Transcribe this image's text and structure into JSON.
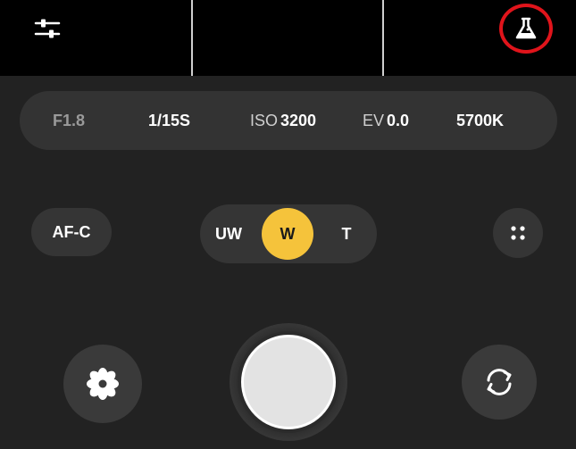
{
  "topbar": {
    "settings_icon": "sliders-icon",
    "lab_icon": "flask-icon",
    "highlight_color": "#e0141b"
  },
  "params": {
    "aperture": "F1.8",
    "shutter": "1/15S",
    "iso_label": "ISO",
    "iso_value": "3200",
    "ev_label": "EV",
    "ev_value": "0.0",
    "white_balance": "5700K"
  },
  "controls": {
    "focus_mode": "AF-C",
    "lenses": {
      "ultra_wide": "UW",
      "wide": "W",
      "tele": "T"
    },
    "active_lens": "W",
    "accent_color": "#f5c33b",
    "more_icon": "four-dots-icon"
  },
  "bottom": {
    "filter_icon": "flower-icon",
    "shutter_icon": "shutter-button",
    "switch_icon": "camera-switch-icon"
  }
}
